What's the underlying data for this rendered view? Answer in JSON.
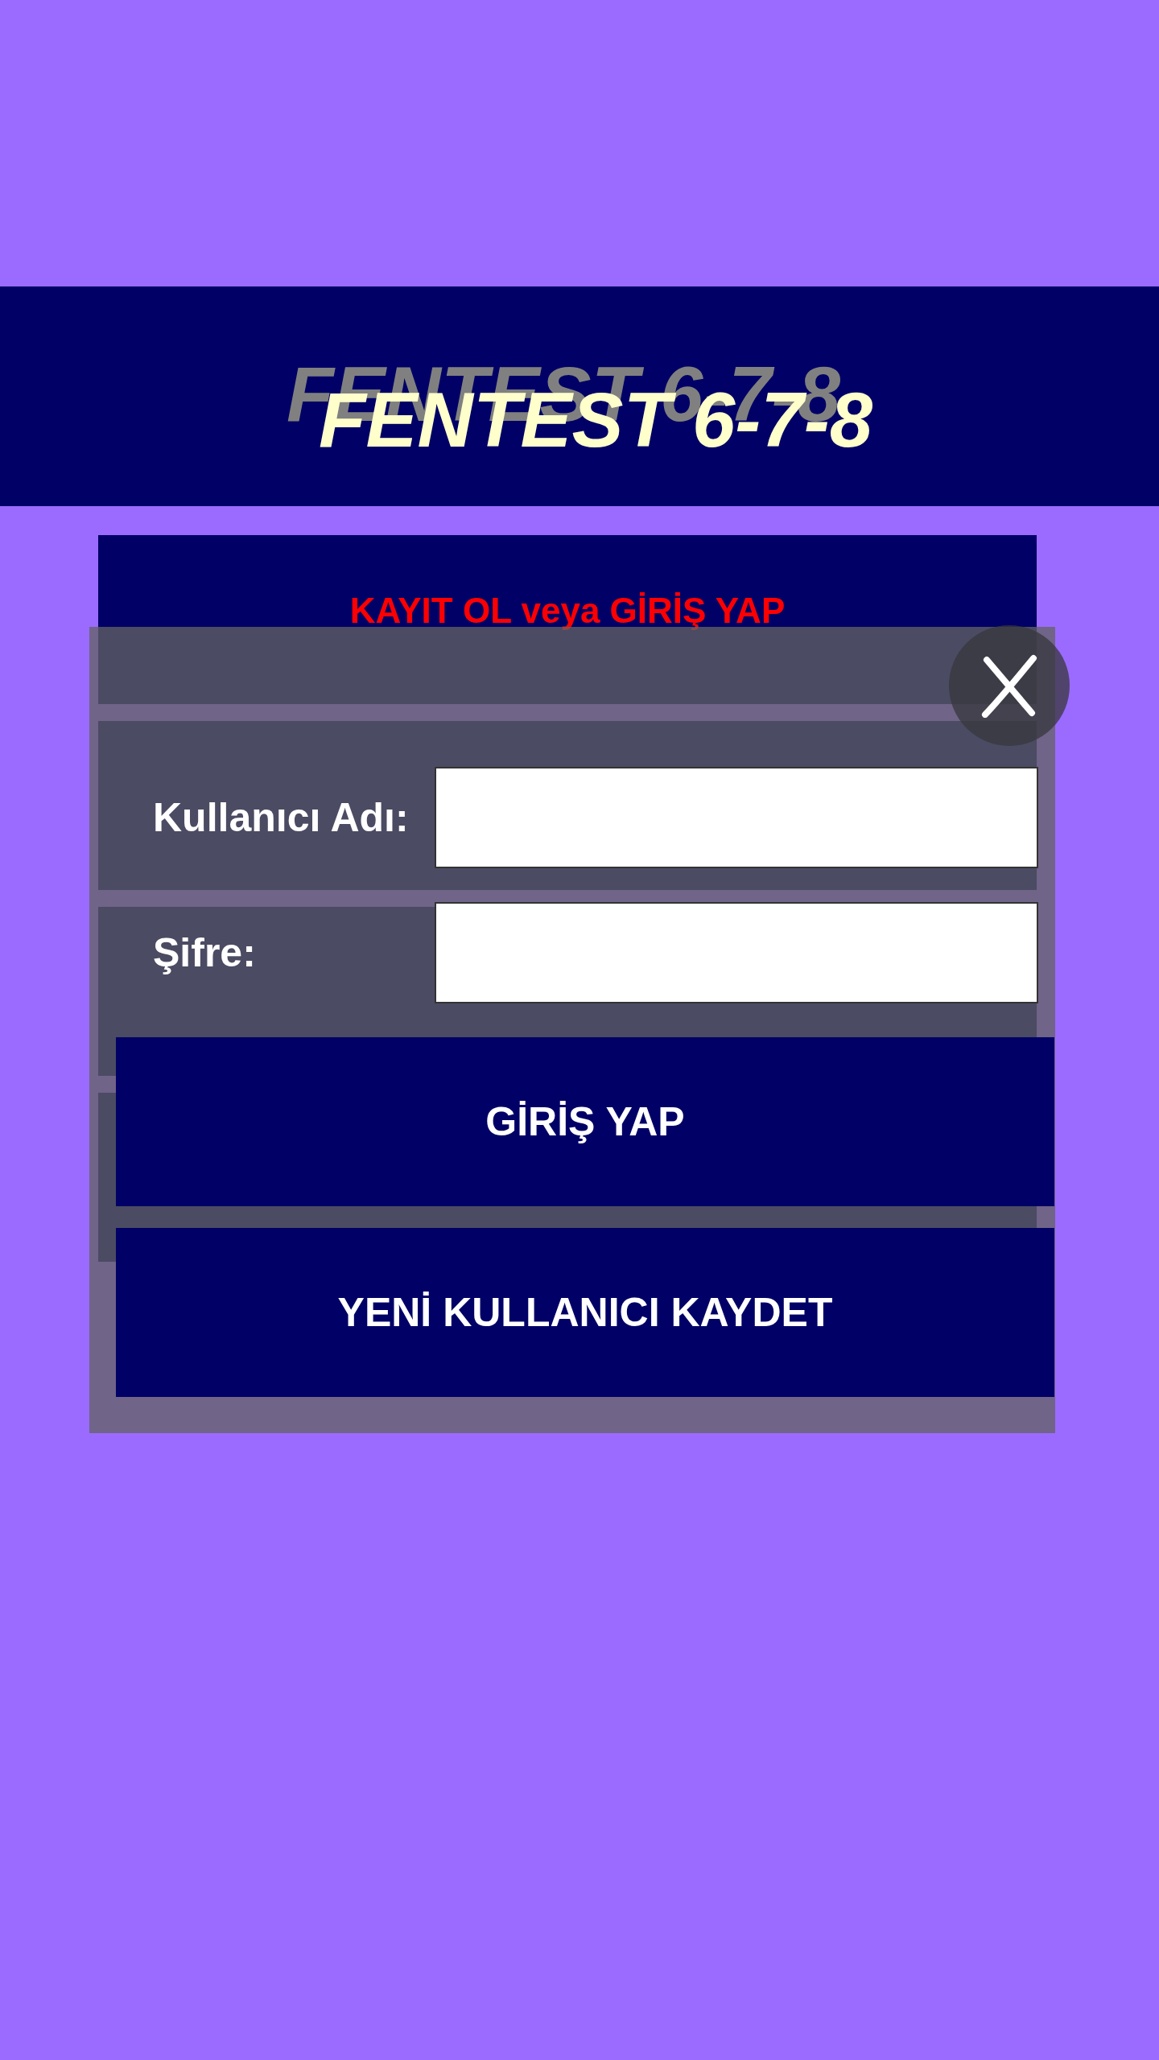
{
  "header": {
    "title": "FENTEST 6-7-8"
  },
  "menu": [
    {
      "label": "KAYIT OL veya GİRİŞ YAP"
    }
  ],
  "login_dialog": {
    "fields": [
      {
        "label": "Kullanıcı Adı:"
      },
      {
        "label": "Şifre:"
      }
    ],
    "buttons": [
      "GİRİŞ YAP",
      "YENİ KULLANICI KAYDET"
    ]
  }
}
